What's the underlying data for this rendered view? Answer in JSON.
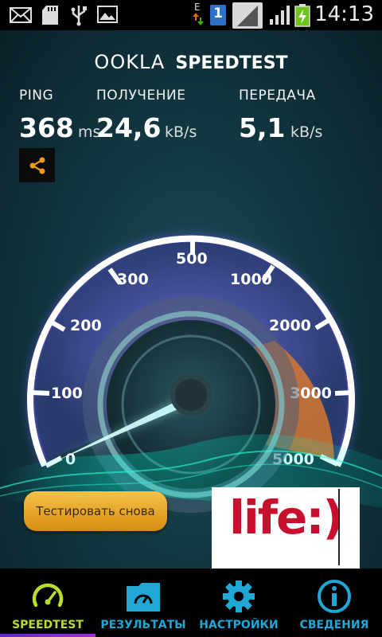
{
  "status_bar": {
    "time": "14:13",
    "network_type": "E",
    "sim_badge": "1",
    "icons": [
      "mail-icon",
      "sd-card-icon",
      "usb-icon",
      "image-icon",
      "data-transfer-icon",
      "sim-card-icon",
      "signal-icon",
      "signal-icon",
      "battery-charging-icon"
    ]
  },
  "header": {
    "logo_ookla": "OOKLA",
    "logo_speedtest": "SPEEDTEST"
  },
  "metrics": {
    "ping": {
      "label": "PING",
      "value": "368",
      "unit": "ms"
    },
    "download": {
      "label": "ПОЛУЧЕНИЕ",
      "value": "24,6",
      "unit": "kB/s"
    },
    "upload": {
      "label": "ПЕРЕДАЧА",
      "value": "5,1",
      "unit": "kB/s"
    }
  },
  "gauge": {
    "ticks": [
      "0",
      "100",
      "200",
      "300",
      "500",
      "1000",
      "2000",
      "3000",
      "5000"
    ],
    "needle_value": 24.6,
    "colors": {
      "ring": "#ffffff",
      "glow": "#8e6bff",
      "highlight": "#e07a2a",
      "face": "#3e4d8a"
    }
  },
  "buttons": {
    "retest": "Тестировать снова"
  },
  "ad": {
    "text": "life:)"
  },
  "bottom_nav": {
    "items": [
      {
        "label": "SPEEDTEST",
        "icon": "speedometer-icon",
        "active": true
      },
      {
        "label": "РЕЗУЛЬТАТЫ",
        "icon": "results-folder-icon",
        "active": false
      },
      {
        "label": "НАСТРОЙКИ",
        "icon": "gear-icon",
        "active": false
      },
      {
        "label": "СВЕДЕНИЯ",
        "icon": "info-icon",
        "active": false
      }
    ]
  },
  "colors": {
    "accent_green": "#b6de2a",
    "accent_blue": "#1fa7d6",
    "button_orange": "#f0b030"
  }
}
